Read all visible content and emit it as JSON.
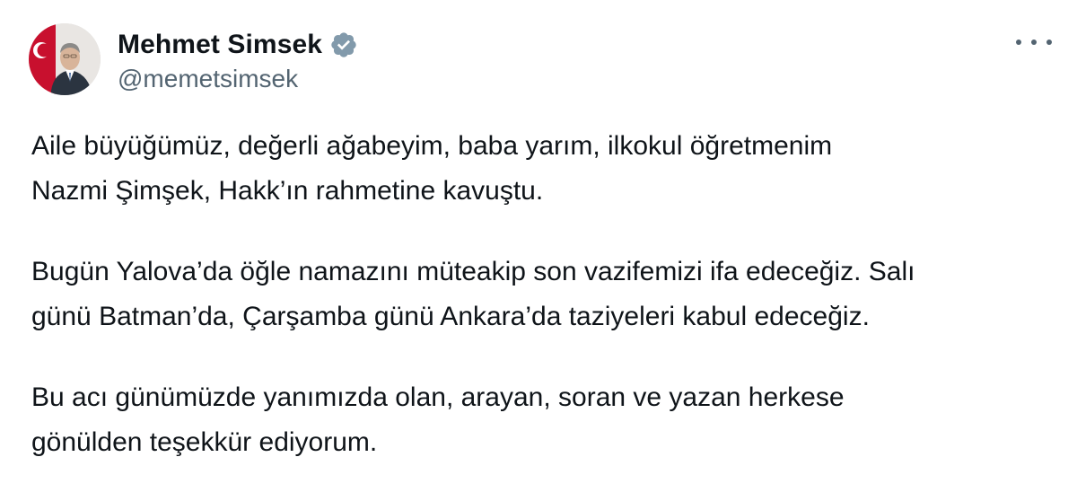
{
  "author": {
    "display_name": "Mehmet Simsek",
    "handle": "@memetsimsek",
    "verified": true,
    "verified_color": "#829aab"
  },
  "more_menu_icon": "more-horizontal-icon",
  "tweet": {
    "paragraphs": [
      {
        "lines": [
          "Aile büyüğümüz, değerli ağabeyim, baba yarım, ilkokul öğretmenim",
          "Nazmi Şimşek, Hakk’ın rahmetine kavuştu."
        ]
      },
      {
        "lines": [
          "Bugün Yalova’da öğle namazını müteakip son vazifemizi ifa edeceğiz. Salı",
          "günü Batman’da, Çarşamba günü Ankara’da taziyeleri kabul edeceğiz."
        ]
      },
      {
        "lines": [
          "Bu acı günümüzde yanımızda olan, arayan, soran ve yazan herkese",
          "gönülden teşekkür ediyorum."
        ]
      }
    ]
  }
}
